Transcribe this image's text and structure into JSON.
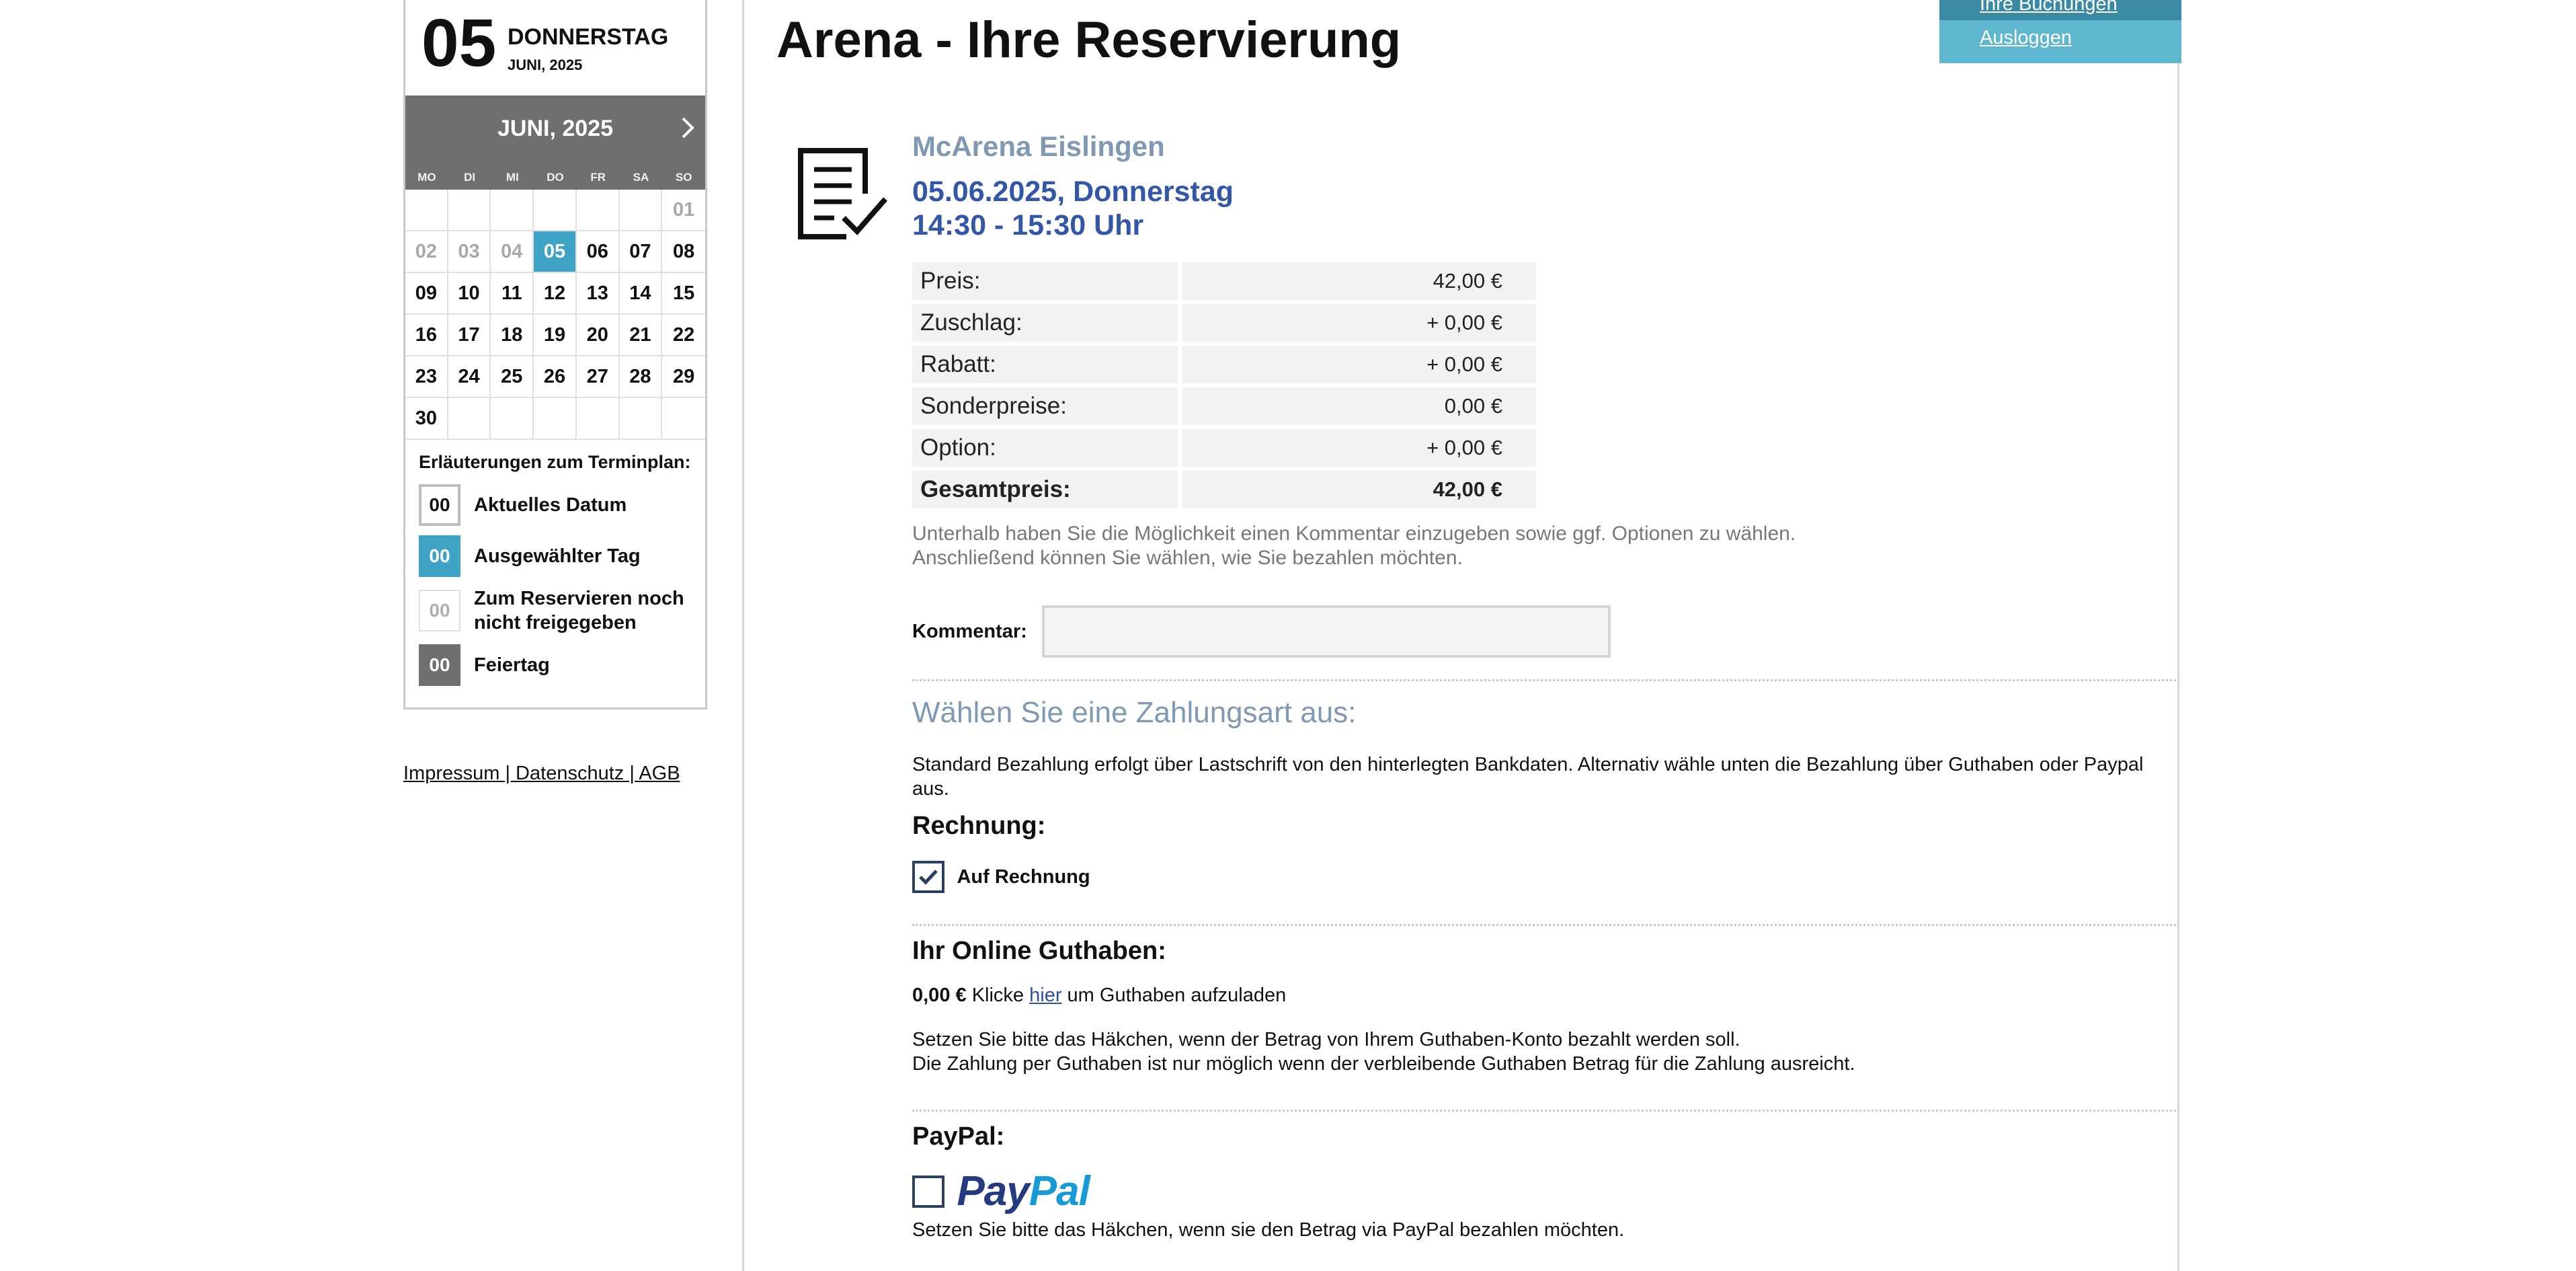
{
  "sidebar": {
    "current_day": "05",
    "current_weekday": "DONNERSTAG",
    "current_month_year": "JUNI, 2025",
    "calendar": {
      "month_title": "JUNI, 2025",
      "weekdays": [
        "MO",
        "DI",
        "MI",
        "DO",
        "FR",
        "SA",
        "SO"
      ],
      "days": [
        "",
        "",
        "",
        "",
        "",
        "",
        "01",
        "02",
        "03",
        "04",
        "05",
        "06",
        "07",
        "08",
        "09",
        "10",
        "11",
        "12",
        "13",
        "14",
        "15",
        "16",
        "17",
        "18",
        "19",
        "20",
        "21",
        "22",
        "23",
        "24",
        "25",
        "26",
        "27",
        "28",
        "29",
        "30",
        "",
        "",
        "",
        "",
        "",
        ""
      ],
      "selected_day": "05",
      "not_released_days": [
        "01",
        "02",
        "03",
        "04"
      ]
    },
    "legend": {
      "title": "Erläuterungen zum Terminplan:",
      "items": [
        {
          "box": "00",
          "label": "Aktuelles Datum"
        },
        {
          "box": "00",
          "label": "Ausgewählter Tag"
        },
        {
          "box": "00",
          "label": "Zum Reservieren noch nicht freigegeben"
        },
        {
          "box": "00",
          "label": "Feiertag"
        }
      ]
    },
    "footer_links": "Impressum | Datenschutz | AGB"
  },
  "header": {
    "title": "Arena - Ihre Reservierung",
    "menu": {
      "bookings": "Ihre Buchungen",
      "logout": "Ausloggen"
    }
  },
  "reservation": {
    "venue": "McArena Eislingen",
    "date_line": "05.06.2025, Donnerstag",
    "time_line": "14:30 - 15:30 Uhr",
    "prices": [
      {
        "label": "Preis:",
        "value": "42,00 €"
      },
      {
        "label": "Zuschlag:",
        "value": "+ 0,00 €"
      },
      {
        "label": "Rabatt:",
        "value": "+ 0,00 €"
      },
      {
        "label": "Sonderpreise:",
        "value": "0,00 €"
      },
      {
        "label": "Option:",
        "value": "+ 0,00 €"
      },
      {
        "label": "Gesamtpreis:",
        "value": "42,00 €"
      }
    ],
    "note_line1": "Unterhalb haben Sie die Möglichkeit einen Kommentar einzugeben sowie ggf. Optionen zu wählen.",
    "note_line2": "Anschließend können Sie wählen, wie Sie bezahlen möchten.",
    "comment_label": "Kommentar:",
    "comment_value": ""
  },
  "payment": {
    "title": "Wählen Sie eine Zahlungsart aus:",
    "standard_text": "Standard Bezahlung erfolgt über Lastschrift von den hinterlegten Bankdaten. Alternativ wähle unten die Bezahlung über Guthaben oder Paypal aus.",
    "invoice_heading": "Rechnung:",
    "invoice_label": "Auf Rechnung",
    "invoice_checked": true,
    "credit_heading": "Ihr Online Guthaben:",
    "credit_amount": "0,00 €",
    "credit_click": "Klicke",
    "credit_link": "hier",
    "credit_rest": "um Guthaben aufzuladen",
    "credit_note1": "Setzen Sie bitte das Häkchen, wenn der Betrag von Ihrem Guthaben-Konto bezahlt werden soll.",
    "credit_note2": "Die Zahlung per Guthaben ist nur möglich wenn der verbleibende Guthaben Betrag für die Zahlung ausreicht.",
    "paypal_heading": "PayPal:",
    "paypal_logo_pay": "Pay",
    "paypal_logo_pal": "Pal",
    "paypal_checked": false,
    "paypal_note": "Setzen Sie bitte das Häkchen, wenn sie den Betrag via PayPal bezahlen möchten."
  }
}
